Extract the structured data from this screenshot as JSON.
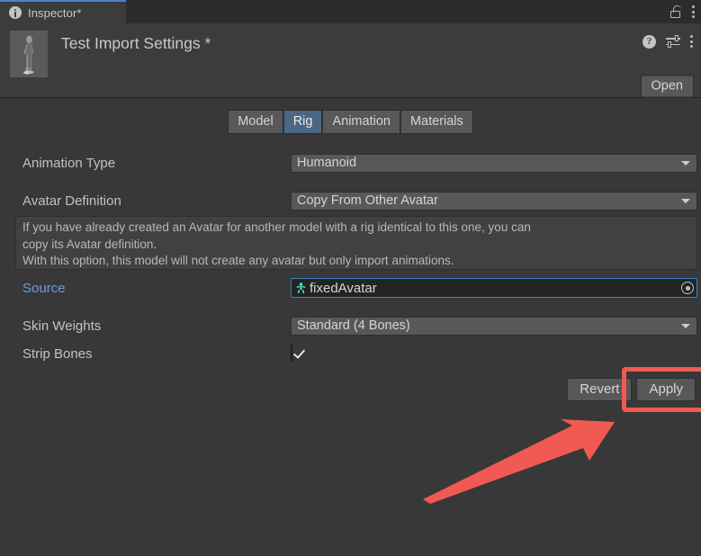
{
  "window": {
    "tab_label": "Inspector*",
    "info_icon": "info-icon",
    "lock_icon": "lock-icon",
    "menu_icon": "kebab-menu-icon"
  },
  "object_header": {
    "title": "Test Import Settings *",
    "thumbnail_alt": "humanoid-model-preview",
    "help_icon": "help-icon",
    "preset_icon": "preset-settings-icon",
    "menu_icon": "kebab-menu-icon",
    "open_label": "Open"
  },
  "tabs": [
    {
      "label": "Model",
      "active": false
    },
    {
      "label": "Rig",
      "active": true
    },
    {
      "label": "Animation",
      "active": false
    },
    {
      "label": "Materials",
      "active": false
    }
  ],
  "fields": {
    "animation_type": {
      "label": "Animation Type",
      "value": "Humanoid"
    },
    "avatar_definition": {
      "label": "Avatar Definition",
      "value": "Copy From Other Avatar"
    },
    "help_text_line1": "If you have already created an Avatar for another model with a rig identical to this one, you can",
    "help_text_line2": "copy its Avatar definition.",
    "help_text_line3": "With this option, this model will not create any avatar but only import animations.",
    "source": {
      "label": "Source",
      "value": "fixedAvatar",
      "icon": "avatar-asset-icon"
    },
    "skin_weights": {
      "label": "Skin Weights",
      "value": "Standard (4 Bones)"
    },
    "strip_bones": {
      "label": "Strip Bones",
      "checked": true
    }
  },
  "buttons": {
    "revert_label": "Revert",
    "apply_label": "Apply"
  },
  "annotation": {
    "highlight_color": "#f05a52",
    "arrow_color": "#f05a52",
    "arrow_target": "apply-button"
  },
  "colors": {
    "background": "#383838",
    "header": "#3c3c3c",
    "tab_active": "#4a6785",
    "link": "#6f9ae8",
    "field_border_focus": "#3d7fd1",
    "avatar_icon": "#49e8c0"
  }
}
